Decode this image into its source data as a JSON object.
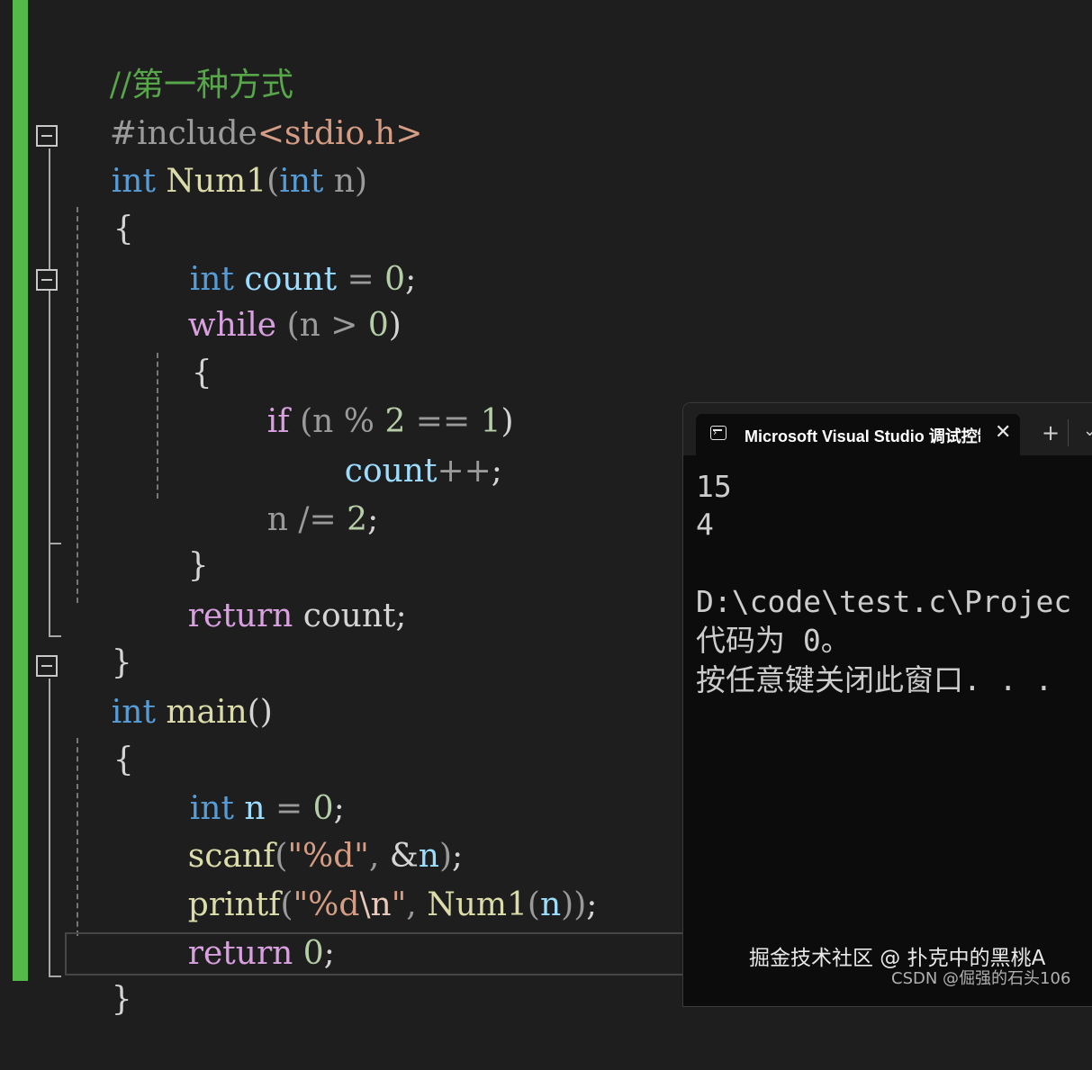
{
  "editor": {
    "lines": {
      "comment": "//第一种方式",
      "include": {
        "directive": "#include",
        "header": "<stdio.h>"
      },
      "num1_sig": {
        "kw": "int",
        "name": "Num1",
        "open": "(",
        "param_kw": "int",
        "param": "n",
        "close": ")"
      },
      "brace_open_1": "{",
      "count_decl": {
        "kw": "int",
        "name": "count",
        "eq": "=",
        "val": "0",
        "semi": ";"
      },
      "while_line": {
        "kw": "while",
        "open": "(",
        "var": "n",
        "op": ">",
        "val": "0",
        "close": ")"
      },
      "brace_open_2": "{",
      "if_line": {
        "kw": "if",
        "open": "(",
        "var": "n",
        "mod": "%",
        "two": "2",
        "eq": "==",
        "one": "1",
        "close": ")"
      },
      "count_inc": {
        "var": "count",
        "op": "++",
        "semi": ";"
      },
      "n_div": {
        "var": "n",
        "op": "/=",
        "val": "2",
        "semi": ";"
      },
      "brace_close_2": "}",
      "return_count": {
        "kw": "return",
        "var": "count",
        "semi": ";"
      },
      "brace_close_1": "}",
      "main_sig": {
        "kw": "int",
        "name": "main",
        "parens": "()"
      },
      "brace_open_3": "{",
      "n_decl": {
        "kw": "int",
        "var": "n",
        "eq": "=",
        "val": "0",
        "semi": ";"
      },
      "scanf_line": {
        "fn": "scanf",
        "open": "(",
        "str": "\"%d\"",
        "comma": ",",
        "amp": "&",
        "arg": "n",
        "close": ")",
        "semi": ";"
      },
      "printf_line": {
        "fn": "printf",
        "open": "(",
        "str1": "\"%d",
        "esc": "\\n",
        "str2": "\"",
        "comma": ",",
        "call": "Num1",
        "open2": "(",
        "arg": "n",
        "close": "))",
        "semi": ";"
      },
      "return_0": {
        "kw": "return",
        "val": "0",
        "semi": ";"
      },
      "brace_close_3": "}"
    }
  },
  "terminal": {
    "tab_title": "Microsoft Visual Studio 调试控制台",
    "tab_close": "✕",
    "new_tab": "+",
    "dropdown": "⌄",
    "output": [
      "15",
      "4",
      "",
      "D:\\code\\test.c\\Projec",
      "代码为 0。",
      "按任意键关闭此窗口. . ."
    ]
  },
  "watermark": {
    "line1": "掘金技术社区 @ 扑克中的黑桃A",
    "line2": "CSDN @倔强的石头106"
  },
  "colors": {
    "background": "#1e1e1e",
    "keyword": "#569cd6",
    "control_keyword": "#d8a0df",
    "function": "#dcdcaa",
    "variable": "#9cdcfe",
    "number": "#b5cea8",
    "string": "#d69d85",
    "comment": "#57a64a",
    "change_bar": "#54b948",
    "terminal_bg": "#0c0c0c"
  }
}
